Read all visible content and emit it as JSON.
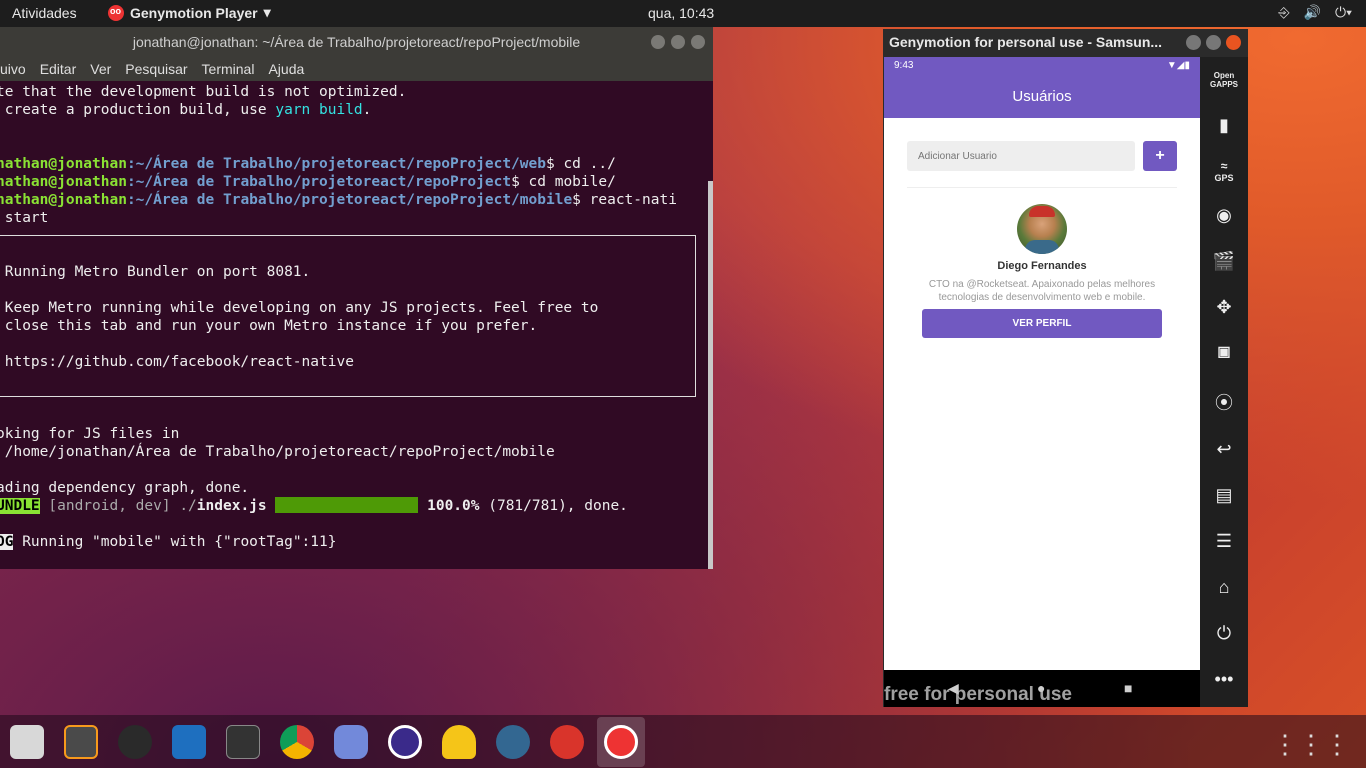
{
  "topbar": {
    "activities": "Atividades",
    "app_name": "Genymotion Player",
    "app_caret": "▾",
    "clock": "qua, 10:43",
    "network_icon": "network-icon",
    "volume_icon": "volume-icon",
    "power_icon": "power-icon"
  },
  "terminal": {
    "title": "jonathan@jonathan: ~/Área de Trabalho/projetoreact/repoProject/mobile",
    "menu": [
      "uivo",
      "Editar",
      "Ver",
      "Pesquisar",
      "Terminal",
      "Ajuda"
    ],
    "lines": {
      "l1": "te that the development build is not optimized.",
      "l2a": " create a production build, use ",
      "l2b": "yarn build",
      "l2c": ".",
      "p1user": "nathan@jonathan",
      "p1path": ":~/Área de Trabalho/projetoreact/repoProject/web",
      "p1cmd": "$ cd ../",
      "p2user": "nathan@jonathan",
      "p2path": ":~/Área de Trabalho/projetoreact/repoProject",
      "p2cmd": "$ cd mobile/",
      "p3user": "nathan@jonathan",
      "p3path": ":~/Área de Trabalho/projetoreact/repoProject/mobile",
      "p3cmd": "$ react-nati",
      "l_start": " start",
      "box1": " Running Metro Bundler on port 8081.",
      "box2": " Keep Metro running while developing on any JS projects. Feel free to",
      "box3": " close this tab and run your own Metro instance if you prefer.",
      "box4": " https://github.com/facebook/react-native",
      "look1": "oking for JS files in",
      "look2": " /home/jonathan/Área de Trabalho/projetoreact/repoProject/mobile",
      "load": "ading dependency graph, done.",
      "bundle_tag": "UNDLE",
      "bundle_target": " [android, dev] ./",
      "bundle_file": "index.js",
      "bundle_pct": "100.0%",
      "bundle_count": " (781/781), done.",
      "log_tag": "OG",
      "log_msg": " Running \"mobile\" with {\"rootTag\":11}"
    }
  },
  "genymotion": {
    "title": "Genymotion for personal use - Samsun...",
    "watermark": "free for personal use",
    "sidebar": {
      "opengapps_line1": "Open",
      "opengapps_line2": "GAPPS",
      "gps_label": "GPS"
    }
  },
  "phone": {
    "time": "9:43",
    "status_icons": "▼◢▮",
    "app_title": "Usuários",
    "input_placeholder": "Adicionar Usuario",
    "add_label": "+",
    "user_name": "Diego Fernandes",
    "user_bio": "CTO na @Rocketseat. Apaixonado pelas melhores tecnologias de desenvolvimento web e mobile.",
    "profile_button": "VER PERFIL",
    "nav_back": "◀",
    "nav_home": "●",
    "nav_recent": "■"
  },
  "dock": {
    "apps": [
      "files-icon",
      "sublime-text-icon",
      "inkscape-icon",
      "vscode-icon",
      "terminal-icon",
      "chrome-icon",
      "discord-icon",
      "eclipse-icon",
      "insomnia-icon",
      "postgres-elephant-icon",
      "robo3t-icon",
      "genymotion-icon"
    ],
    "show_apps": "⋮⋮⋮"
  }
}
